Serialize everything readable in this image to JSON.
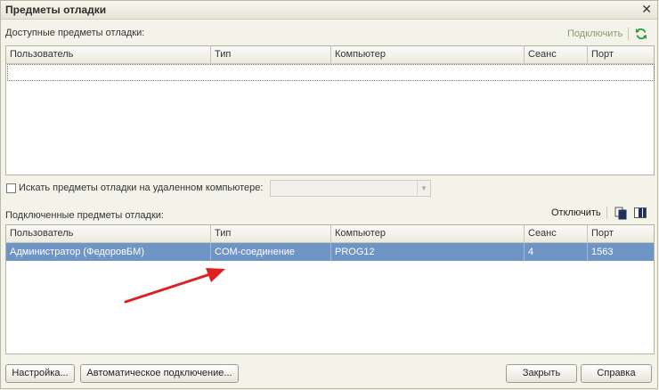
{
  "window": {
    "title": "Предметы отладки",
    "close_glyph": "✕"
  },
  "available": {
    "label": "Доступные предметы отладки:",
    "connect_label": "Подключить",
    "refresh_icon": "refresh-icon",
    "columns": [
      "Пользователь",
      "Тип",
      "Компьютер",
      "Сеанс",
      "Порт"
    ]
  },
  "remote": {
    "checkbox_label": "Искать предметы отладки на удаленном компьютере:",
    "checked": false,
    "combo_value": ""
  },
  "connected": {
    "label": "Подключенные предметы отладки:",
    "disconnect_label": "Отключить",
    "columns": [
      "Пользователь",
      "Тип",
      "Компьютер",
      "Сеанс",
      "Порт"
    ],
    "rows": [
      {
        "user": "Администратор (ФедоровБМ)",
        "type": "COM-соединение",
        "computer": "PROG12",
        "session": "4",
        "port": "1563"
      }
    ],
    "selection_color": "#6f94c6"
  },
  "buttons": {
    "settings": "Настройка...",
    "auto_connect": "Автоматическое подключение...",
    "close": "Закрыть",
    "help": "Справка"
  },
  "annotation": {
    "arrow_color": "#e02020"
  }
}
